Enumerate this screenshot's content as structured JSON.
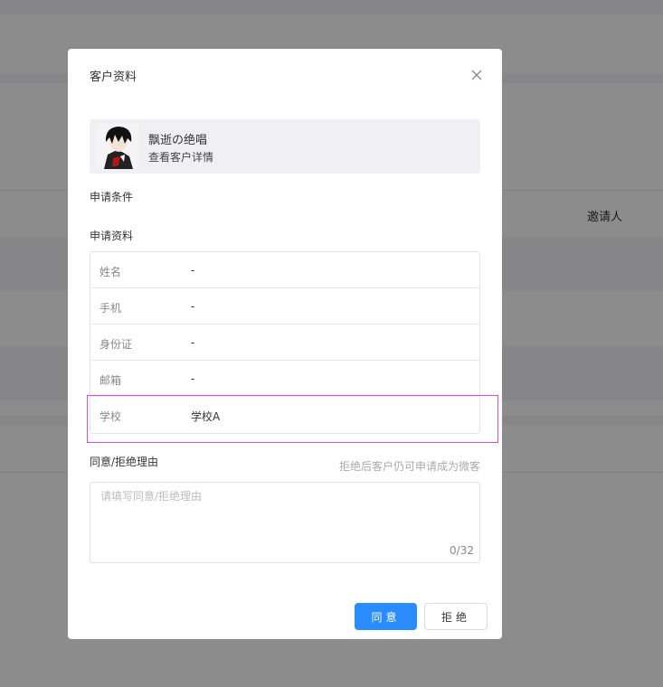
{
  "background": {
    "table_header": "邀请人"
  },
  "modal": {
    "title": "客户资料",
    "customer": {
      "name": "飘逝の绝唱",
      "detail_link": "查看客户详情"
    },
    "sections": {
      "apply_conditions": "申请条件",
      "apply_info": "申请资料"
    },
    "info_rows": [
      {
        "label": "姓名",
        "value": "-"
      },
      {
        "label": "手机",
        "value": "-"
      },
      {
        "label": "身份证",
        "value": "-"
      },
      {
        "label": "邮箱",
        "value": "-"
      },
      {
        "label": "学校",
        "value": "学校A"
      }
    ],
    "reason": {
      "label": "同意/拒绝理由",
      "hint": "拒绝后客户仍可申请成为微客",
      "placeholder": "请填写同意/拒绝理由",
      "value": "",
      "count": "0/32"
    },
    "buttons": {
      "agree": "同意",
      "reject": "拒绝"
    }
  },
  "colors": {
    "primary": "#2a8cff",
    "highlight": "#d94fd9"
  }
}
